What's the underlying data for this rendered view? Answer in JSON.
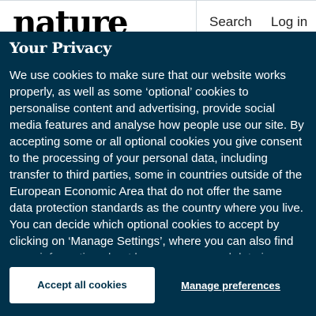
{
  "header": {
    "logo_text": "nature",
    "search_label": "Search",
    "login_label": "Log in"
  },
  "cookie_banner": {
    "title": "Your Privacy",
    "body": "We use cookies to make sure that our website works properly, as well as some ‘optional’ cookies to personalise content and advertising, provide social media features and analyse how people use our site. By accepting some or all optional cookies you give consent to the processing of your personal data, including transfer to third parties, some in countries outside of the European Economic Area that do not offer the same data protection standards as the country where you live. You can decide which optional cookies to accept by clicking on ‘Manage Settings’, where you can also find more information about how your personal data is processed. Further information can be found in our privacy",
    "accept_label": "Accept all cookies",
    "manage_label": "Manage preferences"
  },
  "colors": {
    "banner_bg": "#01324b",
    "accept_button_bg": "#ffffff",
    "text_light": "#ffffff"
  }
}
